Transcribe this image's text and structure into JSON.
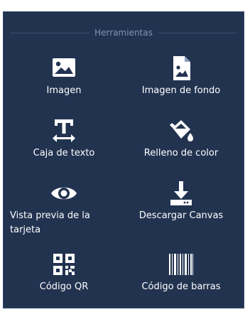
{
  "panel": {
    "title": "Herramientas",
    "colors": {
      "background": "#223350",
      "title": "#8494b4",
      "text": "#ffffff"
    },
    "tools": [
      {
        "label": "Imagen",
        "icon": "image-icon"
      },
      {
        "label": "Imagen de fondo",
        "icon": "background-image-icon"
      },
      {
        "label": "Caja de texto",
        "icon": "text-box-icon"
      },
      {
        "label": "Relleno de color",
        "icon": "paint-bucket-icon"
      },
      {
        "label": "Vista previa de la tarjeta",
        "icon": "eye-icon"
      },
      {
        "label": "Descargar Canvas",
        "icon": "download-icon"
      },
      {
        "label": "Código QR",
        "icon": "qr-code-icon"
      },
      {
        "label": "Código de barras",
        "icon": "barcode-icon"
      }
    ]
  }
}
